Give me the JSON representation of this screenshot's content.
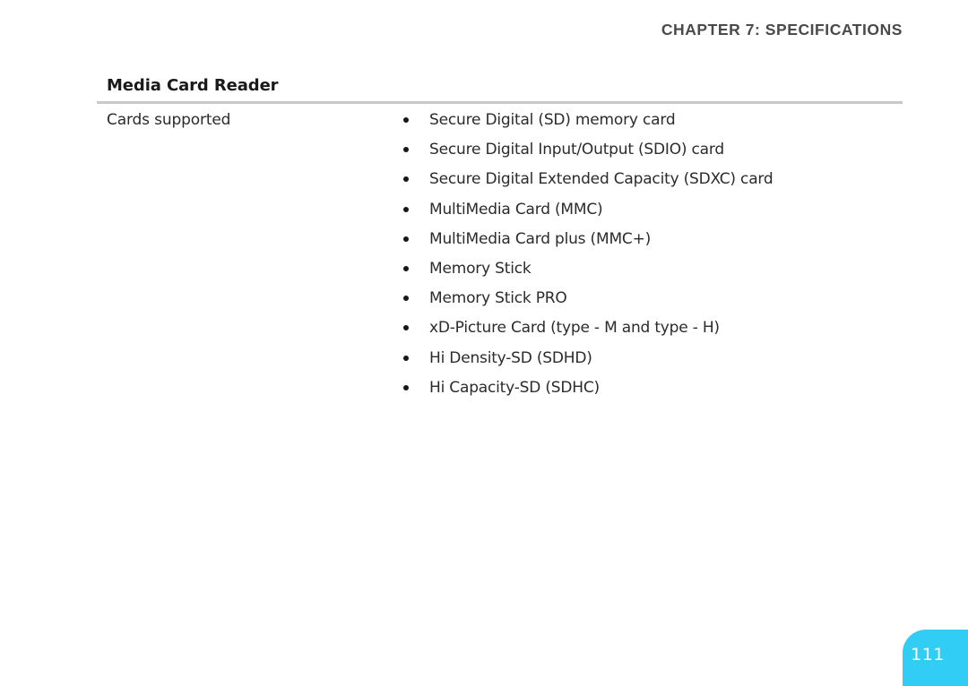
{
  "document": {
    "running_header": "CHAPTER 7: SPECIFICATIONS",
    "page_number": "111"
  },
  "section": {
    "heading": "Media Card Reader",
    "rows": [
      {
        "label": "Cards supported",
        "values": [
          "Secure Digital (SD) memory card",
          "Secure Digital Input/Output (SDIO) card",
          "Secure Digital Extended Capacity (SDXC) card",
          "MultiMedia Card (MMC)",
          "MultiMedia Card plus (MMC+)",
          "Memory Stick",
          "Memory Stick PRO",
          "xD-Picture Card (type - M and type - H)",
          "Hi Density-SD (SDHD)",
          "Hi Capacity-SD (SDHC)"
        ]
      }
    ]
  },
  "theme": {
    "accent": "#31cdf5",
    "rule": "#c9c9c9",
    "header_text": "#4a4a4a",
    "body_text": "#2b2b2b",
    "heading_text": "#1a1a1a",
    "page_background": "#ffffff"
  }
}
